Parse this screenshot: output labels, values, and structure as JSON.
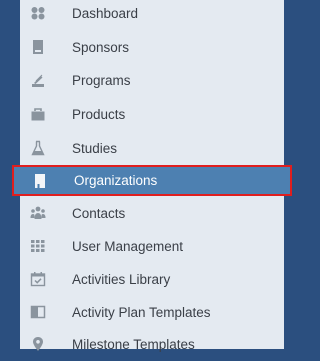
{
  "sidebar": {
    "items": [
      {
        "label": "Dashboard",
        "icon": "dashboard-icon"
      },
      {
        "label": "Sponsors",
        "icon": "sponsor-icon"
      },
      {
        "label": "Programs",
        "icon": "programs-icon"
      },
      {
        "label": "Products",
        "icon": "products-icon"
      },
      {
        "label": "Studies",
        "icon": "studies-flask-icon"
      },
      {
        "label": "Organizations",
        "icon": "organizations-icon",
        "active": true
      },
      {
        "label": "Contacts",
        "icon": "contacts-icon"
      },
      {
        "label": "User Management",
        "icon": "user-management-grid-icon"
      },
      {
        "label": "Activities Library",
        "icon": "calendar-check-icon"
      },
      {
        "label": "Activity Plan Templates",
        "icon": "plan-template-icon"
      },
      {
        "label": "Milestone Templates",
        "icon": "location-pin-icon"
      }
    ]
  },
  "colors": {
    "background": "#2b4f7f",
    "sidebar": "#e4eaf1",
    "active_item": "#4d80b1",
    "active_border": "#e01e1e",
    "icon": "#8a949e"
  }
}
